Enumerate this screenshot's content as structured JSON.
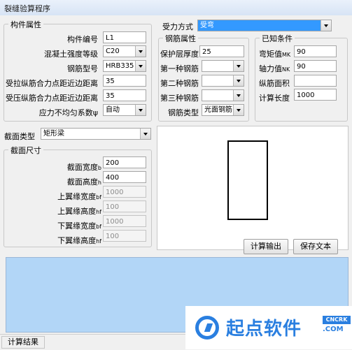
{
  "window": {
    "title": "裂缝验算程序"
  },
  "component": {
    "legend": "构件属性",
    "id_label": "构件编号",
    "id_value": "L1",
    "concrete_label": "混凝土强度等级",
    "concrete_value": "C20",
    "steel_label": "钢筋型号",
    "steel_value": "HRB335",
    "tension_label": "受拉纵筋合力点距近边距离",
    "tension_value": "35",
    "compression_label": "受压纵筋合力点距近边距离",
    "compression_value": "35",
    "uneven_label": "应力不均匀系数ψ",
    "uneven_value": "自动"
  },
  "force": {
    "label": "受力方式",
    "value": "受弯"
  },
  "rebar": {
    "legend": "钢筋属性",
    "cover_label": "保护层厚度",
    "cover_value": "25",
    "first_label": "第一种钢筋",
    "first_value": "",
    "second_label": "第二种钢筋",
    "second_value": "",
    "third_label": "第三种钢筋",
    "third_value": "",
    "type_label": "钢筋类型",
    "type_value": "光面钢筋"
  },
  "known": {
    "legend": "已知条件",
    "moment_label": "弯矩值",
    "moment_sub": "MK",
    "moment_value": "90",
    "axial_label": "轴力值",
    "axial_sub": "NK",
    "axial_value": "90",
    "area_label": "纵筋面积",
    "length_label": "计算长度",
    "length_value": "1000"
  },
  "section": {
    "type_label": "截面类型",
    "type_value": "矩形梁",
    "legend": "截面尺寸",
    "width_label": "截面宽度",
    "width_sub": "b",
    "width_value": "200",
    "height_label": "截面高度",
    "height_sub": "h",
    "height_value": "400",
    "top_w_label": "上翼缘宽度",
    "top_w_sub": "bf",
    "top_w_value": "1000",
    "top_h_label": "上翼缘高度",
    "top_h_sub": "hf",
    "top_h_value": "100",
    "bot_w_label": "下翼缘宽度",
    "bot_w_sub": "bf",
    "bot_w_value": "1000",
    "bot_h_label": "下翼缘高度",
    "bot_h_sub": "hf",
    "bot_h_value": "100"
  },
  "buttons": {
    "calc": "计算输出",
    "save": "保存文本"
  },
  "status": {
    "tab": "计算结果"
  },
  "watermark": {
    "name": "起点软件",
    "badge": "CNCRK",
    "com": ".COM"
  }
}
